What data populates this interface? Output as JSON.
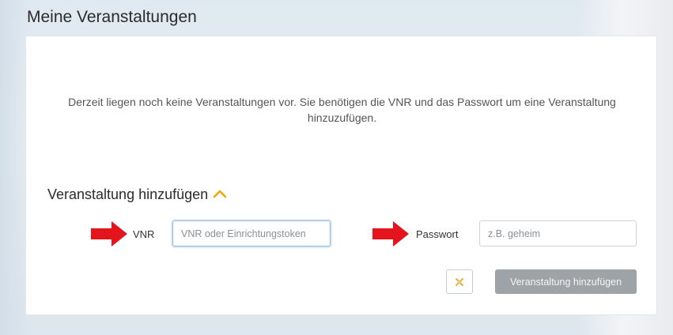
{
  "page": {
    "title": "Meine Veranstaltungen"
  },
  "events": {
    "empty_message": "Derzeit liegen noch keine Veranstaltungen vor. Sie benötigen die VNR und das Passwort um eine Veranstaltung hinzuzufügen."
  },
  "add_event": {
    "section_title": "Veranstaltung hinzufügen",
    "vnr_label": "VNR",
    "vnr_placeholder": "VNR oder Einrichtungstoken",
    "vnr_value": "",
    "password_label": "Passwort",
    "password_placeholder": "z.B. geheim",
    "password_value": "",
    "submit_label": "Veranstaltung hinzufügen"
  },
  "icons": {
    "collapse": "chevron-up-icon",
    "clear": "clear-x-icon",
    "annotation_arrow": "red-arrow-right-icon"
  },
  "colors": {
    "accent_chevron": "#f0a500",
    "arrow_red": "#e3141b",
    "submit_disabled_bg": "#9ea3a8"
  }
}
